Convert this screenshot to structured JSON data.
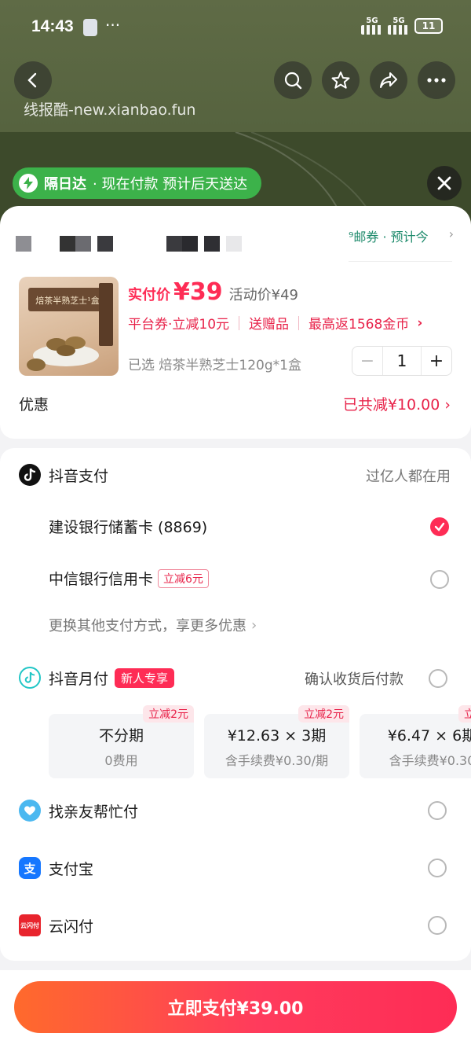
{
  "status_bar": {
    "time": "14:43",
    "dots": "···",
    "network_1": "5G",
    "network_2": "5G",
    "battery": "11"
  },
  "watermark": "线报酷-new.xianbao.fun",
  "delivery": {
    "title": "隔日达",
    "text": "· 现在付款 预计后天送达"
  },
  "coupon_hint": "⁹邮券 · 预计今",
  "product": {
    "image_caption": "焙茶半熟芝士¹盒",
    "price_label": "实付价",
    "price": "¥39",
    "activity_price": "活动价¥49",
    "promos": [
      "平台券·立减10元",
      "送赠品",
      "最高返1568金币"
    ],
    "selected": "已选  焙茶半熟芝士120g*1盒",
    "quantity": "1",
    "minus": "−",
    "plus": "+"
  },
  "discount": {
    "label": "优惠",
    "value": "已共减¥10.00",
    "chevron": "›"
  },
  "douyin_pay": {
    "title": "抖音支付",
    "subtitle": "过亿人都在用",
    "cards": [
      {
        "name": "建设银行储蓄卡 (8869)",
        "selected": true
      },
      {
        "name": "中信银行信用卡",
        "tag": "立减6元",
        "selected": false
      }
    ],
    "more": "更换其他支付方式，享更多优惠",
    "more_chevron": "›"
  },
  "monthly_pay": {
    "title": "抖音月付",
    "tag": "新人专享",
    "subtitle": "确认收货后付款",
    "plans": [
      {
        "badge": "立减2元",
        "line1": "不分期",
        "line2": "0费用"
      },
      {
        "badge": "立减2元",
        "line1": "¥12.63 × 3期",
        "line2": "含手续费¥0.30/期"
      },
      {
        "badge": "立",
        "line1": "¥6.47 × 6期",
        "line2": "含手续费¥0.30"
      }
    ]
  },
  "other_methods": [
    {
      "name": "找亲友帮忙付",
      "icon": "heart-icon"
    },
    {
      "name": "支付宝",
      "icon": "alipay-icon",
      "glyph": "支"
    },
    {
      "name": "云闪付",
      "icon": "unionpay-icon",
      "glyph": "云闪付"
    }
  ],
  "pay_button": "立即支付¥39.00",
  "colors": {
    "accent": "#fe2c55",
    "green": "#3cb24a",
    "teal": "#1d8a6b"
  }
}
